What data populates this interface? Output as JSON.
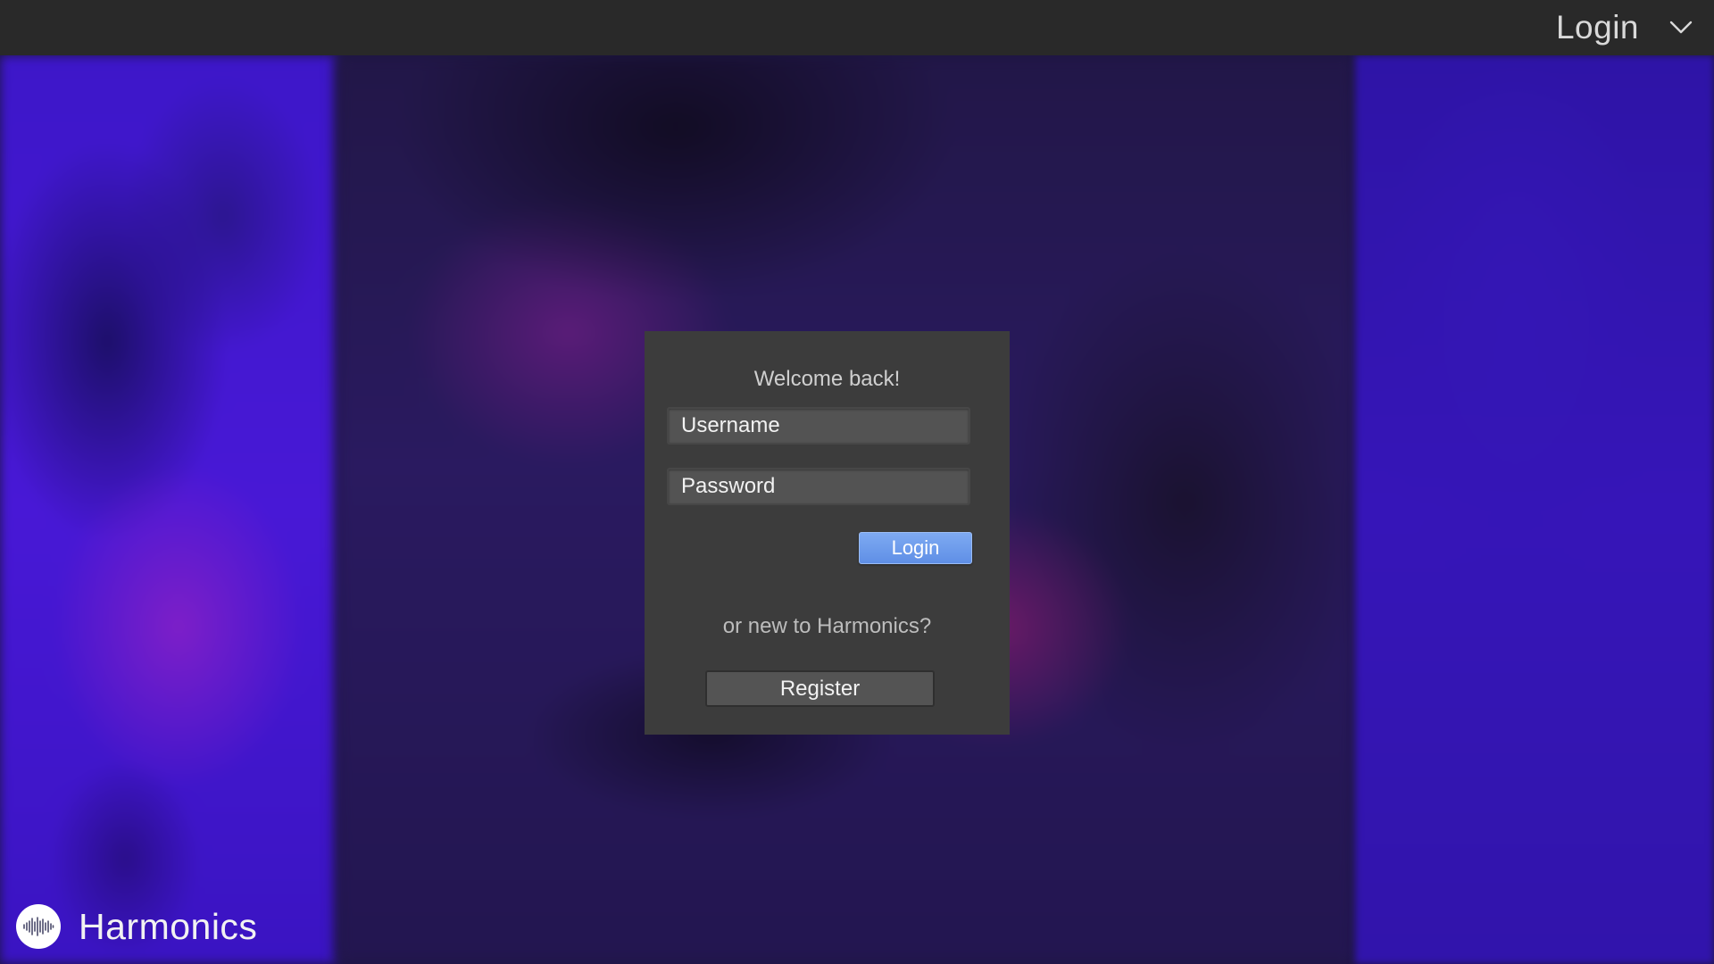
{
  "header": {
    "account_menu_label": "Login",
    "menu_icon": "chevron-down-icon"
  },
  "login_card": {
    "welcome_text": "Welcome back!",
    "username_placeholder": "Username",
    "password_placeholder": "Password",
    "login_button_label": "Login",
    "new_user_text": "or new to Harmonics?",
    "register_button_label": "Register"
  },
  "brand": {
    "name": "Harmonics",
    "logo_icon": "sound-wave-icon"
  },
  "colors": {
    "topbar": "#292929",
    "card": "#3c3c3c",
    "accent_button": "#6a98ea",
    "background_purple": "#3d17c9"
  }
}
